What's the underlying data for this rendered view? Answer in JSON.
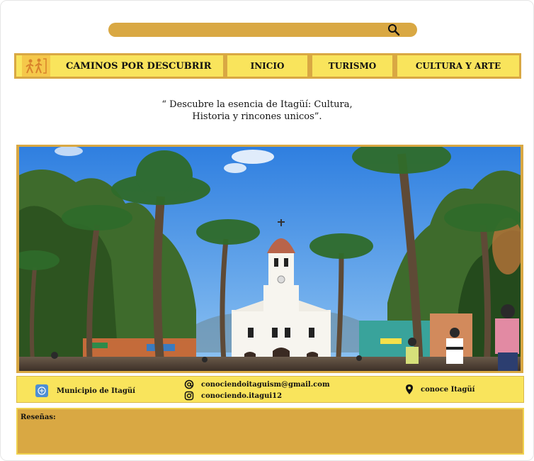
{
  "search": {
    "placeholder": ""
  },
  "nav": {
    "brand": "CAMINOS POR DESCUBRIR",
    "items": [
      "INICIO",
      "TURISMO",
      "CULTURA Y ARTE"
    ]
  },
  "quote": {
    "line1": "“ Descubre la esencia de Itagüí: Cultura,",
    "line2": "Historia y rincones unicos”."
  },
  "hero": {
    "icons": [
      "church-icon",
      "palm-tree-icon"
    ]
  },
  "footer": {
    "municipality": "Municipio de Itagüí",
    "email": "conociendoitaguism@gmail.com",
    "instagram": "conociendo.itagui12",
    "location": "conoce Itagüí"
  },
  "reviews": {
    "label": "Reseñas:"
  },
  "colors": {
    "gold": "#d9a843",
    "yellow": "#f9e45c",
    "sky": "#3f8fe6"
  }
}
